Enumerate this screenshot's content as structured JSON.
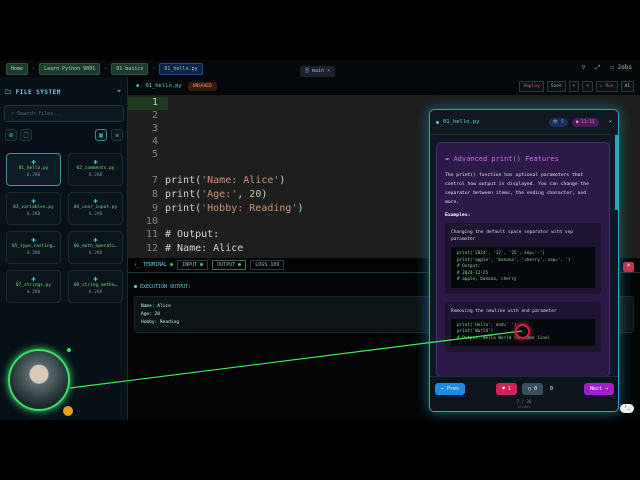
{
  "breadcrumb": [
    "Home",
    "Learn Python 9001",
    "01-basics",
    "01_hello.py"
  ],
  "center_tab": "main",
  "top_right": {
    "user": "Jobs"
  },
  "sidebar": {
    "title": "FILE SYSTEM",
    "search_placeholder": "Search files...",
    "files": [
      {
        "name": "01_hello.py",
        "size": "0.2KB"
      },
      {
        "name": "02_comments.py",
        "size": "0.2KB"
      },
      {
        "name": "03_variables.py",
        "size": "0.2KB"
      },
      {
        "name": "04_user_input.py",
        "size": "0.2KB"
      },
      {
        "name": "05_type_casting…",
        "size": "0.2KB"
      },
      {
        "name": "06_math_operati…",
        "size": "0.2KB"
      },
      {
        "name": "07_strings.py",
        "size": "0.2KB"
      },
      {
        "name": "08_string_metho…",
        "size": "0.2KB"
      }
    ]
  },
  "editor": {
    "filename": "01_hello.py",
    "status": "UNSAVED",
    "actions": [
      "Deploy",
      "Save",
      "↶",
      "↷",
      "▷ Run",
      "AI"
    ],
    "line_numbers": [
      "1",
      "2",
      "3",
      "4",
      "5",
      "7",
      "8",
      "9",
      "10",
      "11",
      "12"
    ]
  },
  "terminal": {
    "title": "TERMINAL",
    "tabs": [
      "INPUT",
      "OUTPUT",
      "LOGS 109"
    ],
    "section": "EXECUTION OUTPUT:",
    "output": [
      "Name: Alice",
      "Age: 20",
      "Hobby: Reading"
    ]
  },
  "panel": {
    "filename": "01_hello.py",
    "views": "5",
    "timer": "11:11",
    "title": "Advanced print() Features",
    "intro": "The print() function has optional parameters that control how output is displayed. You can change the separator between items, the ending character, and more.",
    "examples_label": "Examples:",
    "ex1_desc": "Changing the default space separator with sep parameter",
    "ex1_code": [
      "print('2024', '12', '25', sep='-')",
      "print('apple', 'banana', 'cherry', sep=', ')",
      "# Output:",
      "# 2024-12-25",
      "# apple, banana, cherry"
    ],
    "ex2_desc": "Removing the newline with end parameter",
    "ex2_code": [
      "print('Hello', end=' ')",
      "print('World')",
      "# Output: Hello World (on same line)"
    ],
    "prev": "← Prev",
    "next": "Next →",
    "likes": "1",
    "comments": "0",
    "shares": "0",
    "page": "7 / 36",
    "page_label": "slides"
  }
}
